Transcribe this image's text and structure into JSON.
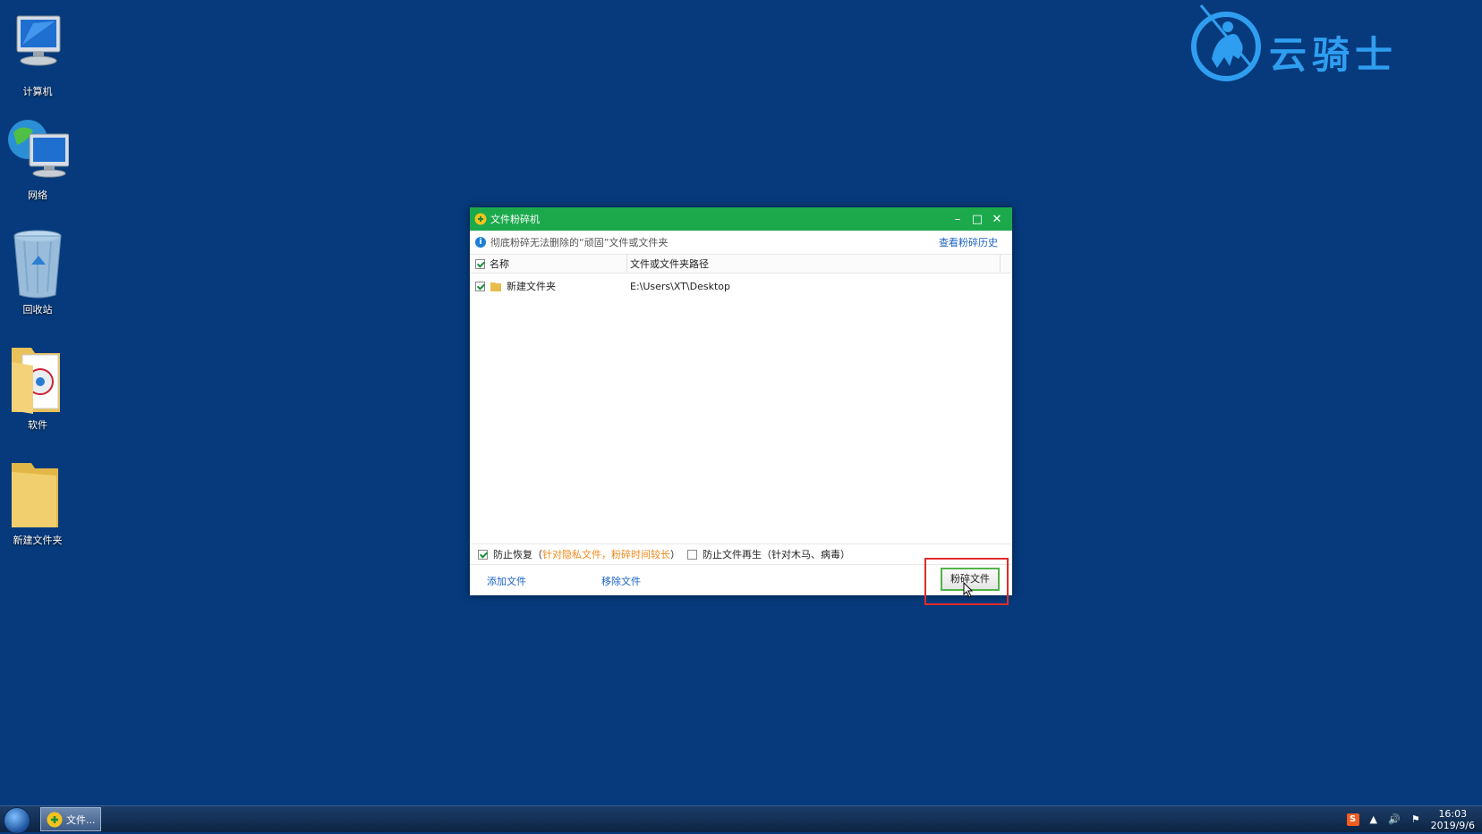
{
  "desktop_icons": [
    {
      "label": "计算机",
      "icon": "computer-icon"
    },
    {
      "label": "网络",
      "icon": "network-icon"
    },
    {
      "label": "回收站",
      "icon": "recycle-bin-icon"
    },
    {
      "label": "软件",
      "icon": "folder-icon"
    },
    {
      "label": "新建文件夹",
      "icon": "folder-icon"
    }
  ],
  "logo": {
    "text": "云骑士",
    "color": "#2f9ef0"
  },
  "window": {
    "title": "文件粉碎机",
    "controls": {
      "minimize": "–",
      "maximize": "□",
      "close": "✕"
    },
    "info_text": "彻底粉碎无法删除的“顽固”文件或文件夹",
    "history_link": "查看粉碎历史",
    "columns": {
      "name": "名称",
      "path": "文件或文件夹路径"
    },
    "files": [
      {
        "checked": true,
        "name": "新建文件夹",
        "path": "E:\\Users\\XT\\Desktop"
      }
    ],
    "options": {
      "prevent_recovery": {
        "checked": true,
        "label": "防止恢复（",
        "note": "针对隐私文件，粉碎时间较长",
        "close": "）"
      },
      "prevent_regen": {
        "checked": false,
        "label": "防止文件再生（针对木马、病毒）"
      }
    },
    "add_file": "添加文件",
    "remove_file": "移除文件",
    "shred_button": "粉碎文件"
  },
  "taskbar": {
    "task_label": "文件...",
    "time": "16:03",
    "date": "2019/9/6"
  },
  "colors": {
    "titlebar": "#1ba94c",
    "desktop": "#063a7c",
    "highlight": "#e02b2b"
  }
}
